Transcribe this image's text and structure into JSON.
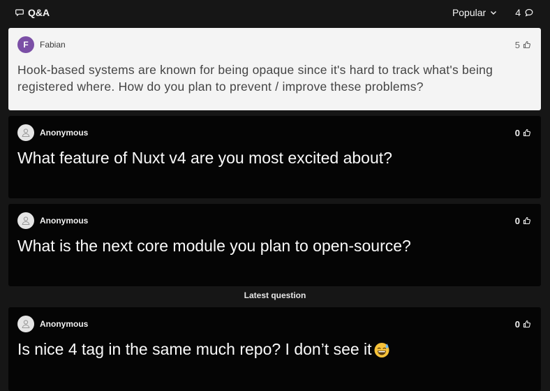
{
  "header": {
    "title": "Q&A",
    "sort_label": "Popular",
    "question_count": "4"
  },
  "section_label": "Latest question",
  "questions": [
    {
      "author": "Fabian",
      "avatar_letter": "F",
      "votes": "5",
      "text": "Hook-based systems are known for being opaque since it's hard to track what's being registered where. How do you plan to prevent / improve these problems?"
    },
    {
      "author": "Anonymous",
      "votes": "0",
      "text": "What feature of Nuxt v4 are you most excited about?"
    },
    {
      "author": "Anonymous",
      "votes": "0",
      "text": "What is the next core module you plan to open-source?"
    },
    {
      "author": "Anonymous",
      "votes": "0",
      "text": "Is nice 4 tag in the same much repo? I don’t see it",
      "emoji": "grinning-sweat-emoji"
    }
  ]
}
